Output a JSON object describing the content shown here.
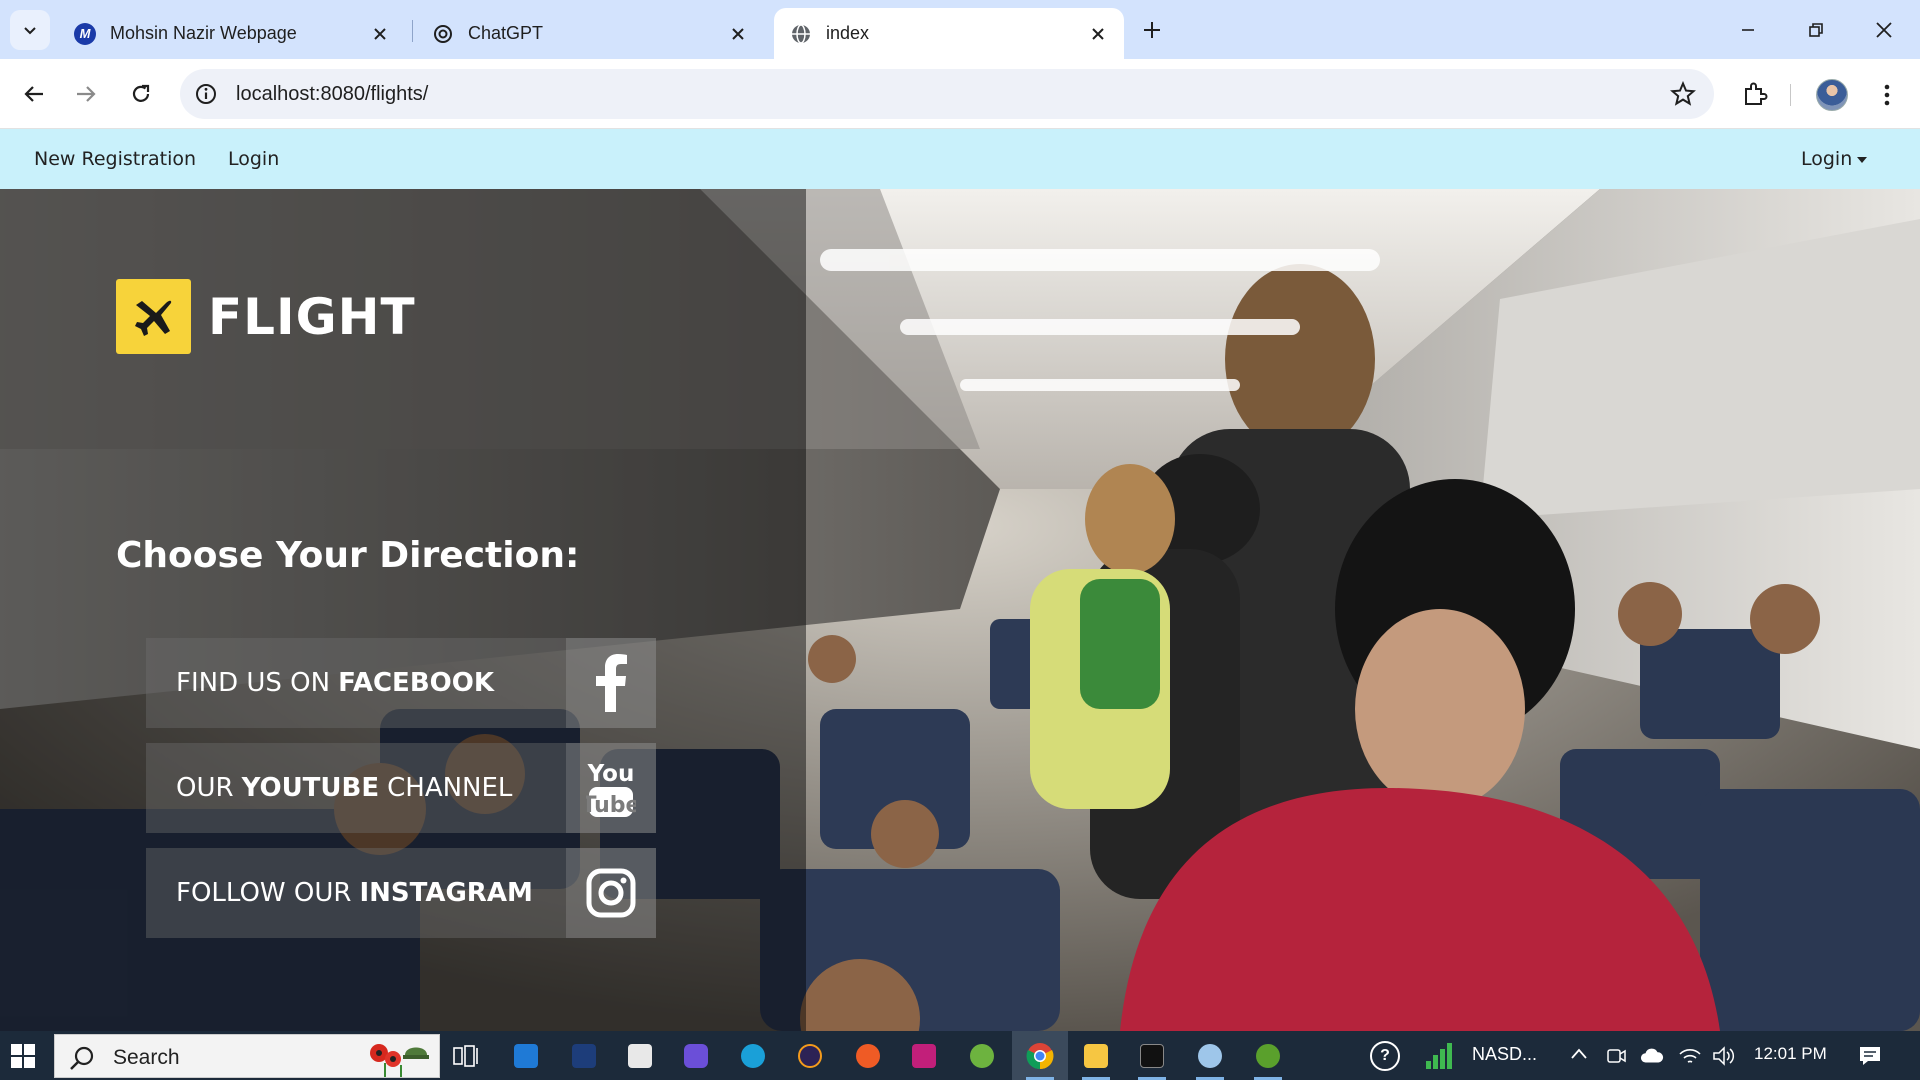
{
  "browser": {
    "tabs": [
      {
        "title": "Mohsin Nazir Webpage",
        "favicon": "M"
      },
      {
        "title": "ChatGPT",
        "favicon": "chatgpt-logo"
      },
      {
        "title": "index",
        "favicon": "globe-icon"
      }
    ],
    "active_tab": 2,
    "url": "localhost:8080/flights/"
  },
  "site_nav": {
    "new_registration": "New Registration",
    "login": "Login",
    "login_dropdown": "Login"
  },
  "hero": {
    "logo_text": "FLIGHT",
    "heading": "Choose Your Direction:",
    "social": [
      {
        "pre": "FIND US ON",
        "bold": "FACEBOOK",
        "post": "",
        "icon": "facebook-icon"
      },
      {
        "pre": "OUR",
        "bold": "YOUTUBE",
        "post": "CHANNEL",
        "icon": "youtube-icon"
      },
      {
        "pre": "FOLLOW OUR",
        "bold": "INSTAGRAM",
        "post": "",
        "icon": "instagram-icon"
      }
    ]
  },
  "taskbar": {
    "search_placeholder": "Search",
    "stock_ticker": "NASD...",
    "time": "12:01 PM"
  },
  "colors": {
    "tabstrip": "#d3e3fd",
    "site_nav": "#c9f1fb",
    "logo_yellow": "#f7d33a",
    "taskbar": "#1c2a3a"
  }
}
